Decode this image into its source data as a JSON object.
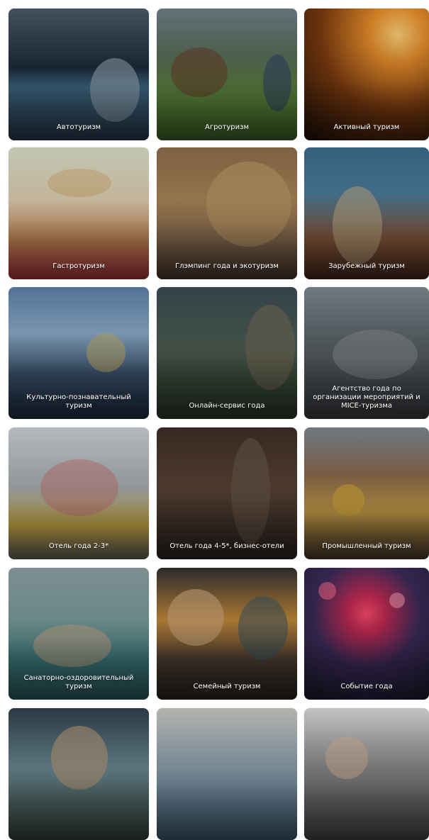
{
  "cards": [
    {
      "label": "Автотуризм"
    },
    {
      "label": "Агротуризм"
    },
    {
      "label": "Активный туризм"
    },
    {
      "label": "Гастротуризм"
    },
    {
      "label": "Глэмпинг года и экотуризм"
    },
    {
      "label": "Зарубежный туризм"
    },
    {
      "label": "Культурно-познавательный туризм"
    },
    {
      "label": "Онлайн-сервис года"
    },
    {
      "label": "Агентство года по организации мероприятий и MICE-туризма"
    },
    {
      "label": "Отель года 2-3*"
    },
    {
      "label": "Отель года 4-5*, бизнес-отели"
    },
    {
      "label": "Промышленный туризм"
    },
    {
      "label": "Санаторно-оздоровительный туризм"
    },
    {
      "label": "Семейный туризм"
    },
    {
      "label": "Событие года"
    },
    {
      "label": ""
    },
    {
      "label": ""
    },
    {
      "label": ""
    }
  ]
}
